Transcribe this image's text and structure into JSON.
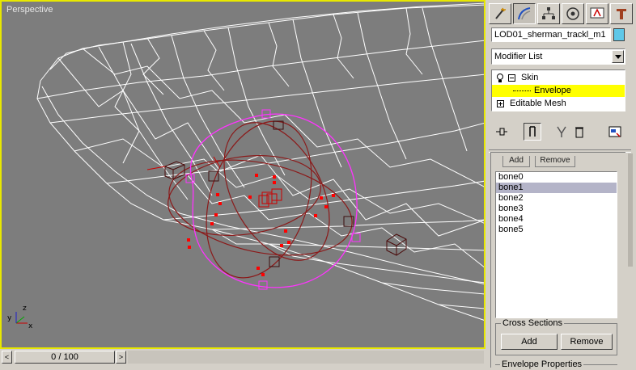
{
  "viewport": {
    "label": "Perspective"
  },
  "timeslider": {
    "prev_label": "<",
    "next_label": ">",
    "frame_readout": "0 / 100"
  },
  "panel": {
    "tabs": [
      {
        "icon": "create-icon"
      },
      {
        "icon": "modify-icon"
      },
      {
        "icon": "hierarchy-icon"
      },
      {
        "icon": "motion-icon"
      },
      {
        "icon": "display-icon"
      },
      {
        "icon": "utilities-icon"
      }
    ],
    "object_name": "LOD01_sherman_trackl_m1",
    "object_color": "#5fc8e8",
    "modifier_list_label": "Modifier List",
    "stack": {
      "skin": "Skin",
      "envelope": "Envelope",
      "editable_mesh": "Editable Mesh"
    },
    "rollout_tabs": [
      "Add",
      "Remove"
    ],
    "bones": [
      "bone0",
      "bone1",
      "bone2",
      "bone3",
      "bone4",
      "bone5"
    ],
    "selected_bone_index": 1,
    "cross_sections": {
      "title": "Cross Sections",
      "add_label": "Add",
      "remove_label": "Remove"
    },
    "envelope_properties_title": "Envelope Properties"
  },
  "colors": {
    "viewport_bg": "#7d7d7d",
    "active_border": "#e8e800",
    "wire": "#ffffff",
    "envelope": "#8b1a1a",
    "selected_envelope": "#ff33ff",
    "selection_highlight": "#ffff00"
  }
}
